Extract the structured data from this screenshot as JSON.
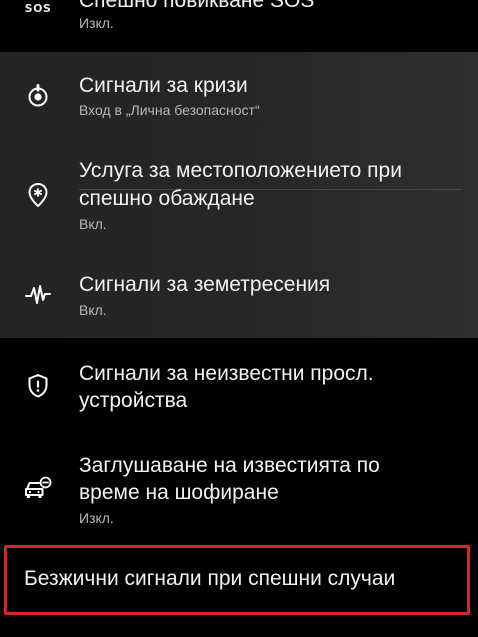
{
  "items": {
    "sos": {
      "icon_label": "SOS",
      "title": "Спешно повикване SOS",
      "subtitle": "Изкл."
    },
    "crisis": {
      "title": "Сигнали за кризи",
      "subtitle": "Вход в „Лична безопасност“"
    },
    "location": {
      "title_line1": "Услуга за местоположението при",
      "title_line2": "спешно обаждане",
      "subtitle": "Вкл."
    },
    "earthquake": {
      "title": "Сигнали за земетресения",
      "subtitle": "Вкл."
    },
    "unknown_trackers": {
      "title_line1": "Сигнали за неизвестни просл.",
      "title_line2": "устройства"
    },
    "driving": {
      "title_line1": "Заглушаване на известията по",
      "title_line2": "време на шофиране",
      "subtitle": "Изкл."
    },
    "wireless": {
      "title": "Безжични сигнали при спешни случаи"
    }
  },
  "colors": {
    "background": "#000000",
    "group_background": "#262626",
    "highlight_border": "#d7252c",
    "primary_text": "#f2f2f2",
    "secondary_text": "#b8b8b8"
  },
  "icons": {
    "sos": "sos-text-icon",
    "crisis": "crisis-alert-icon",
    "location": "location-pin-asterisk-icon",
    "earthquake": "seismic-wave-icon",
    "unknown_trackers": "shield-exclamation-icon",
    "driving": "car-notification-icon"
  }
}
